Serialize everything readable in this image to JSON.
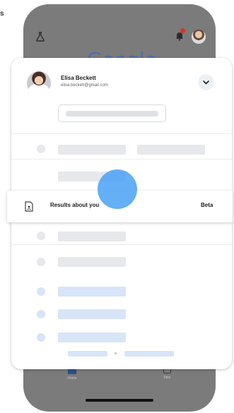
{
  "corner_text": "s",
  "phone": {
    "brand_logo_text": "Google",
    "nav": {
      "home_label": "Home",
      "tabs_label": "Tabs"
    }
  },
  "account": {
    "name": "Elisa Beckett",
    "email": "elisa.beckett@gmail.com"
  },
  "results_item": {
    "label": "Results about you",
    "badge": "Beta"
  },
  "colors": {
    "tap_indicator": "#429ef4",
    "skeleton_gray": "#e6e8eb",
    "skeleton_blue": "#d8e4f8",
    "notification_dot": "#d93025"
  }
}
